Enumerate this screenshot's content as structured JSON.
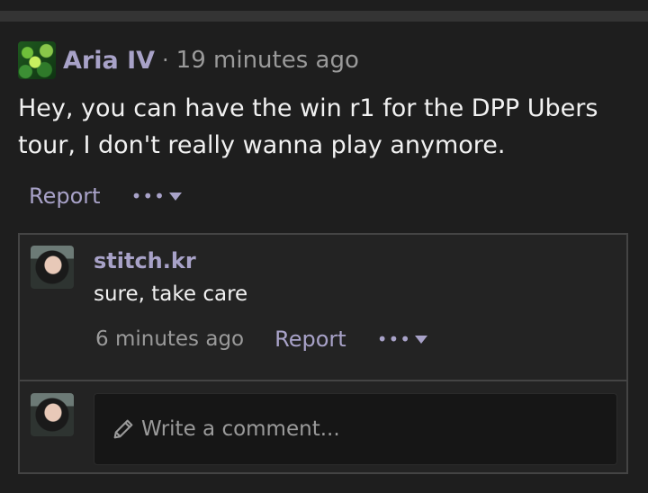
{
  "post": {
    "author": "Aria IV",
    "separator": "·",
    "time": "19 minutes ago",
    "body": "Hey, you can have the win r1 for the DPP Ubers tour, I don't really wanna play anymore.",
    "report_label": "Report",
    "more_label": "•••"
  },
  "reply": {
    "author": "stitch.kr",
    "text": "sure, take care",
    "time": "6 minutes ago",
    "report_label": "Report",
    "more_label": "•••"
  },
  "composer": {
    "placeholder": "Write a comment..."
  },
  "icons": {
    "more": "ellipsis-icon",
    "dropdown": "caret-down-icon",
    "edit": "pencil-icon"
  },
  "colors": {
    "accent": "#a8a2c8",
    "background": "#1e1e1e",
    "muted_text": "#9a9a9a"
  }
}
